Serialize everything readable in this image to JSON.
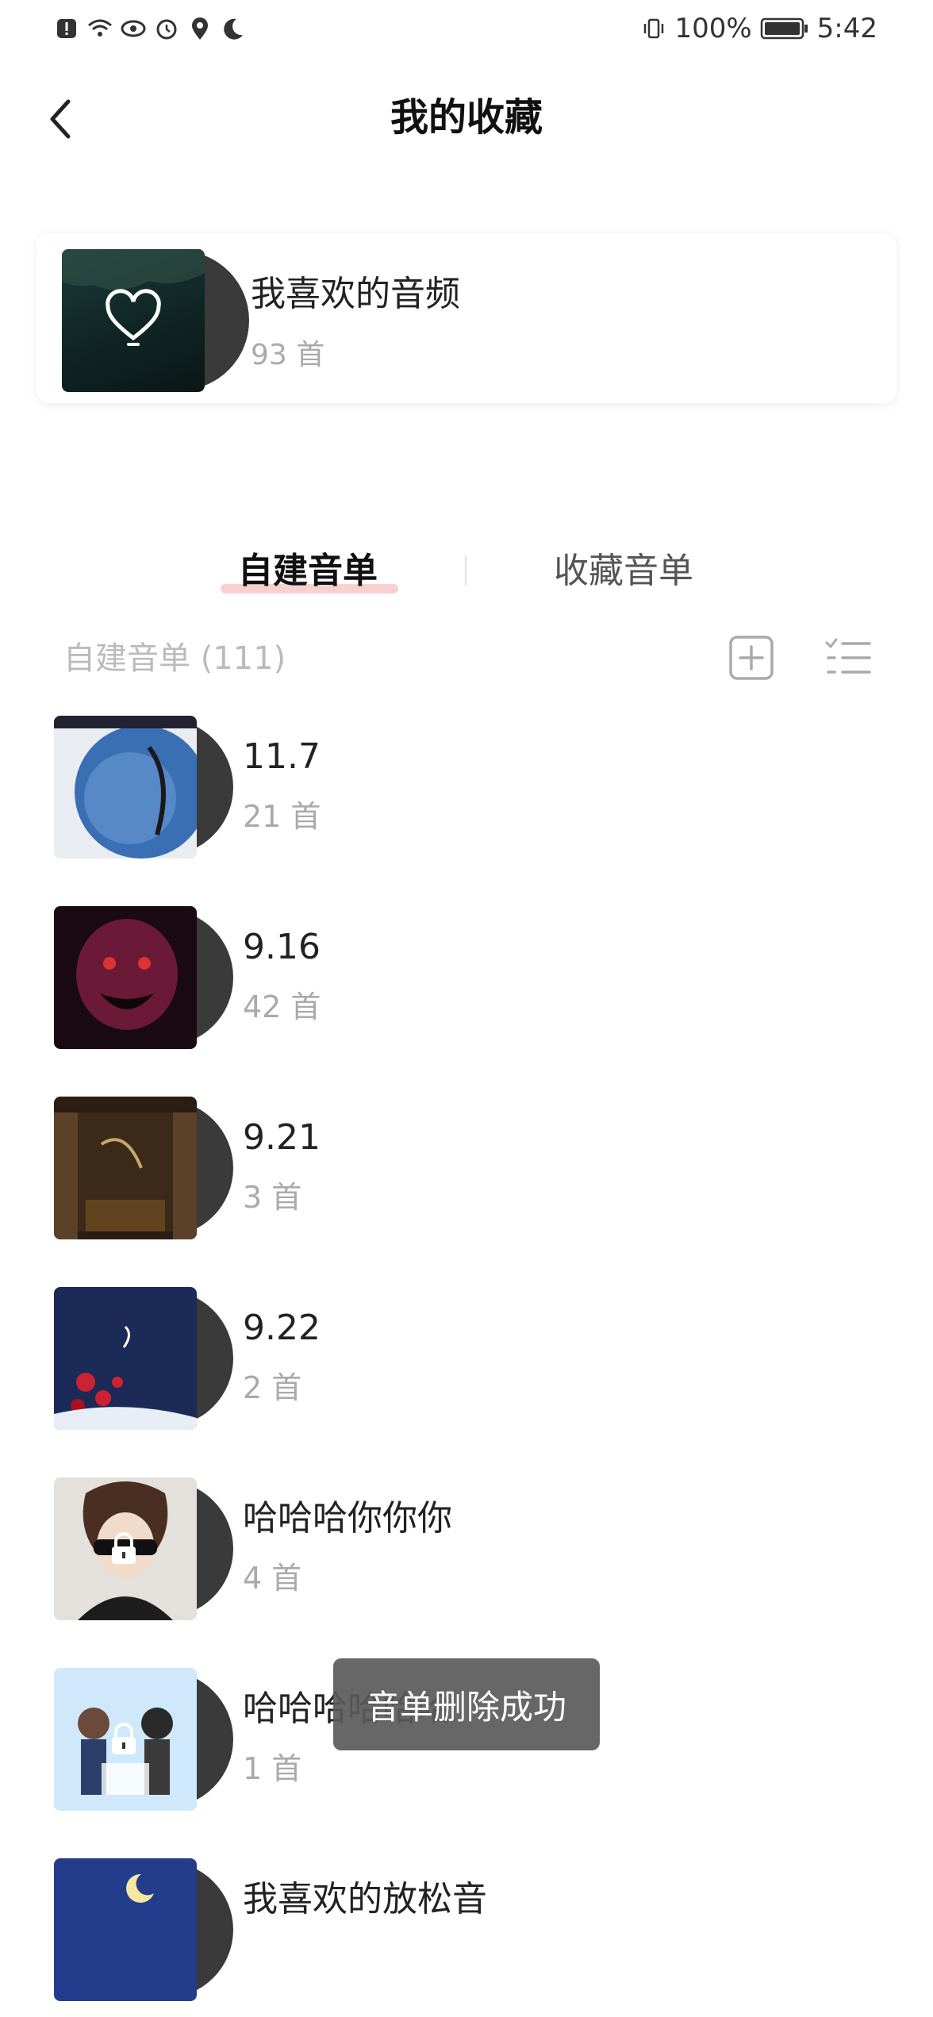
{
  "status_bar": {
    "battery": "100%",
    "time": "5:42",
    "icons_left": [
      "alert-icon",
      "wifi-icon",
      "eye-icon",
      "alarm-icon",
      "location-icon",
      "moon-icon"
    ],
    "icons_right": [
      "vibrate-icon",
      "battery-icon"
    ]
  },
  "header": {
    "title": "我的收藏"
  },
  "favorites": {
    "title": "我喜欢的音频",
    "count": "93 首"
  },
  "tabs": [
    {
      "label": "自建音单",
      "active": true
    },
    {
      "label": "收藏音单",
      "active": false
    }
  ],
  "section": {
    "label": "自建音单 (111)"
  },
  "playlists": [
    {
      "title": "11.7",
      "count": "21 首",
      "locked": false,
      "cover": "#3a6fb4"
    },
    {
      "title": "9.16",
      "count": "42 首",
      "locked": false,
      "cover": "#6a1a36"
    },
    {
      "title": "9.21",
      "count": "3 首",
      "locked": false,
      "cover": "#3b2a19"
    },
    {
      "title": "9.22",
      "count": "2 首",
      "locked": false,
      "cover": "#1c2a57"
    },
    {
      "title": "哈哈哈你你你",
      "count": "4 首",
      "locked": true,
      "cover": "#d8d2cc"
    },
    {
      "title": "哈哈哈哈哈哈",
      "count": "1 首",
      "locked": true,
      "cover": "#a9d2f2"
    },
    {
      "title": "我喜欢的放松音",
      "count": "",
      "locked": false,
      "cover": "#233d8c"
    }
  ],
  "toast": {
    "message": "音单删除成功"
  },
  "colors": {
    "accent_underline": "#ef7878",
    "secondary_text": "#aaaaaa",
    "toast_bg": "#5a5a5a"
  }
}
